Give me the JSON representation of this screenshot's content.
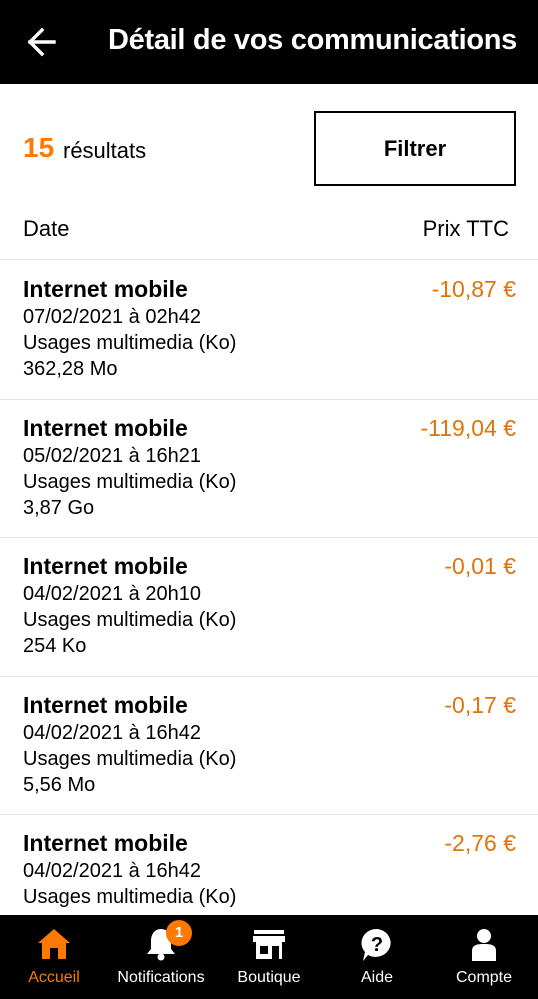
{
  "header": {
    "title": "Détail de vos communications",
    "back_icon": "arrow-left-icon"
  },
  "summary": {
    "count": "15",
    "count_label": "résultats",
    "filter_label": "Filtrer"
  },
  "columns": {
    "date": "Date",
    "price": "Prix TTC"
  },
  "rows": [
    {
      "title": "Internet mobile",
      "datetime": "07/02/2021 à 02h42",
      "usage": "Usages multimedia (Ko)",
      "volume": "362,28 Mo",
      "price": "-10,87 €"
    },
    {
      "title": "Internet mobile",
      "datetime": "05/02/2021 à 16h21",
      "usage": "Usages multimedia (Ko)",
      "volume": "3,87 Go",
      "price": "-119,04 €"
    },
    {
      "title": "Internet mobile",
      "datetime": "04/02/2021 à 20h10",
      "usage": "Usages multimedia (Ko)",
      "volume": "254 Ko",
      "price": "-0,01 €"
    },
    {
      "title": "Internet mobile",
      "datetime": "04/02/2021 à 16h42",
      "usage": "Usages multimedia (Ko)",
      "volume": "5,56 Mo",
      "price": "-0,17 €"
    },
    {
      "title": "Internet mobile",
      "datetime": "04/02/2021 à 16h42",
      "usage": "Usages multimedia (Ko)",
      "volume": "",
      "price": "-2,76 €"
    }
  ],
  "tabs": [
    {
      "label": "Accueil",
      "icon": "home-icon",
      "active": true
    },
    {
      "label": "Notifications",
      "icon": "bell-icon",
      "badge": "1"
    },
    {
      "label": "Boutique",
      "icon": "shop-icon"
    },
    {
      "label": "Aide",
      "icon": "help-icon"
    },
    {
      "label": "Compte",
      "icon": "user-icon"
    }
  ],
  "colors": {
    "accent": "#ff7900",
    "price": "#e0730a",
    "bar": "#000000"
  }
}
